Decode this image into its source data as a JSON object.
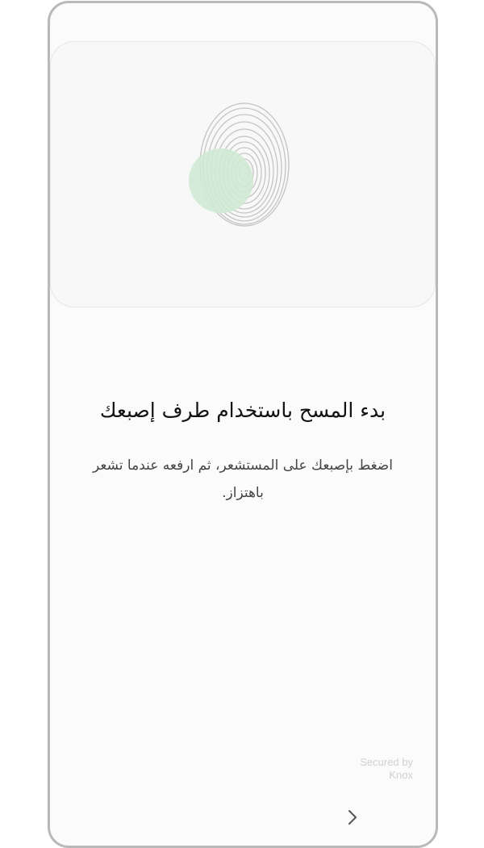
{
  "setup": {
    "title": "بدء المسح باستخدام طرف إصبعك",
    "instruction": "اضغط بإصبعك على المستشعر، ثم ارفعه عندما تشعر باهتزاز."
  },
  "footer": {
    "secured_line1": "Secured by",
    "secured_line2": "Knox",
    "next_icon": "chevron-right-icon"
  },
  "colors": {
    "progress_blob": "#cfe9d3",
    "fingerprint_lines": "#bdbdbd",
    "frame": "#b9b9b9"
  }
}
